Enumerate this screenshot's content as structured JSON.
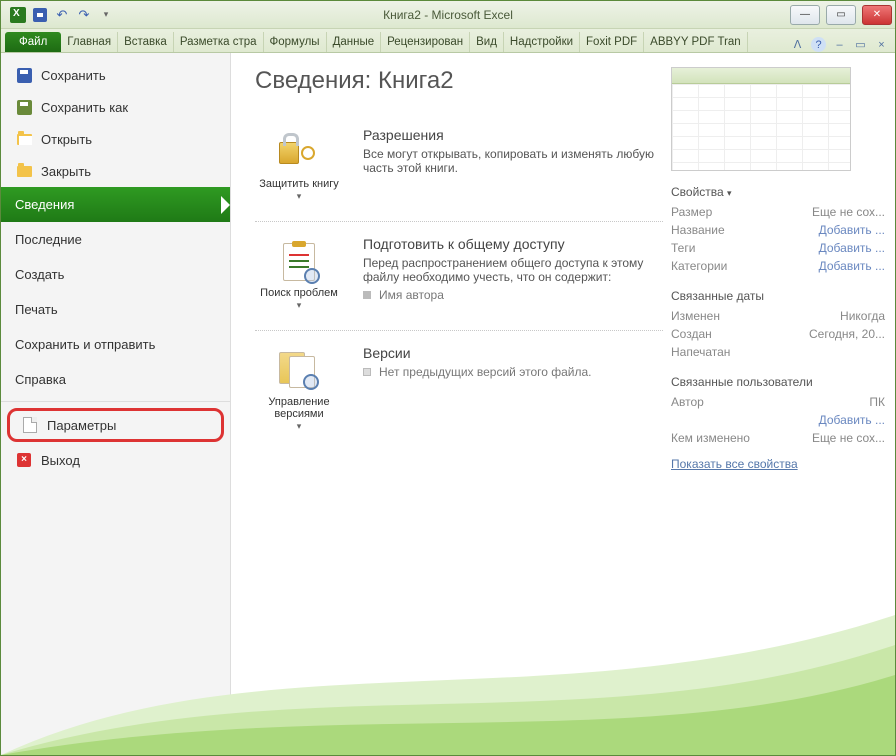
{
  "title": "Книга2  -  Microsoft Excel",
  "ribbon": {
    "file": "Файл",
    "tabs": [
      "Главная",
      "Вставка",
      "Разметка стра",
      "Формулы",
      "Данные",
      "Рецензирован",
      "Вид",
      "Надстройки",
      "Foxit PDF",
      "ABBYY PDF Tran"
    ]
  },
  "sidebar": {
    "save": "Сохранить",
    "save_as": "Сохранить как",
    "open": "Открыть",
    "close": "Закрыть",
    "info": "Сведения",
    "recent": "Последние",
    "new": "Создать",
    "print": "Печать",
    "share": "Сохранить и отправить",
    "help": "Справка",
    "options": "Параметры",
    "exit": "Выход"
  },
  "info": {
    "title": "Сведения: Книга2",
    "perm": {
      "btn": "Защитить книгу",
      "hdr": "Разрешения",
      "text": "Все могут открывать, копировать и изменять любую часть этой книги."
    },
    "prep": {
      "btn": "Поиск проблем",
      "hdr": "Подготовить к общему доступу",
      "text": "Перед распространением общего доступа к этому файлу необходимо учесть, что он содержит:",
      "bullet": "Имя автора"
    },
    "ver": {
      "btn": "Управление версиями",
      "hdr": "Версии",
      "text": "Нет предыдущих версий этого файла."
    }
  },
  "props": {
    "hdr": "Свойства",
    "size_k": "Размер",
    "size_v": "Еще не сох...",
    "title_k": "Название",
    "title_v": "Добавить ...",
    "tags_k": "Теги",
    "tags_v": "Добавить ...",
    "cat_k": "Категории",
    "cat_v": "Добавить ...",
    "dates_hdr": "Связанные даты",
    "mod_k": "Изменен",
    "mod_v": "Никогда",
    "created_k": "Создан",
    "created_v": "Сегодня, 20...",
    "printed_k": "Напечатан",
    "people_hdr": "Связанные пользователи",
    "author_k": "Автор",
    "author_v": "ПК",
    "author_add": "Добавить ...",
    "lastmod_k": "Кем изменено",
    "lastmod_v": "Еще не сох...",
    "show_all": "Показать все свойства"
  }
}
